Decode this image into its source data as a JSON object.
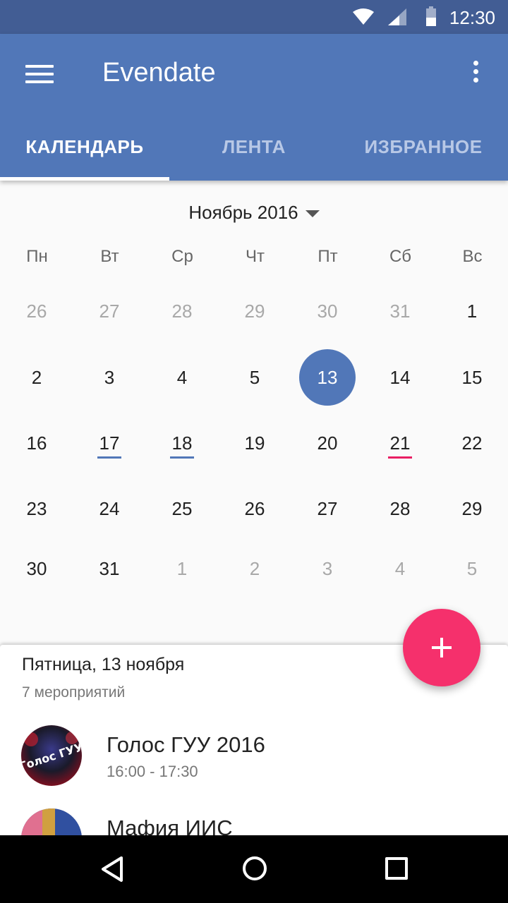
{
  "status": {
    "time": "12:30"
  },
  "app": {
    "title": "Evendate"
  },
  "tabs": [
    {
      "label": "КАЛЕНДАРЬ",
      "active": true
    },
    {
      "label": "ЛЕНТА",
      "active": false
    },
    {
      "label": "ИЗБРАННОЕ",
      "active": false
    }
  ],
  "calendar": {
    "month_label": "Ноябрь 2016",
    "weekdays": [
      "Пн",
      "Вт",
      "Ср",
      "Чт",
      "Пт",
      "Сб",
      "Вс"
    ],
    "weeks": [
      [
        "26",
        "27",
        "28",
        "29",
        "30",
        "31",
        "1"
      ],
      [
        "2",
        "3",
        "4",
        "5",
        "13",
        "14",
        "15"
      ],
      [
        "16",
        "17",
        "18",
        "19",
        "20",
        "21",
        "22"
      ],
      [
        "23",
        "24",
        "25",
        "26",
        "27",
        "28",
        "29"
      ],
      [
        "30",
        "31",
        "1",
        "2",
        "3",
        "4",
        "5"
      ]
    ],
    "selected_day": "13",
    "marked_days": {
      "17": "#5177b8",
      "18": "#5177b8",
      "21": "#e91e63"
    }
  },
  "events_panel": {
    "date": "Пятница, 13 ноября",
    "count": "7 мероприятий",
    "events": [
      {
        "title": "Голос ГУУ 2016",
        "time": "16:00 - 17:30",
        "avatar_text": "Голос ГУУ"
      },
      {
        "title": "Мафия ИИС",
        "time": ""
      }
    ]
  },
  "colors": {
    "primary": "#5177b8",
    "status_bar": "#425d94",
    "accent": "#f5306c"
  }
}
